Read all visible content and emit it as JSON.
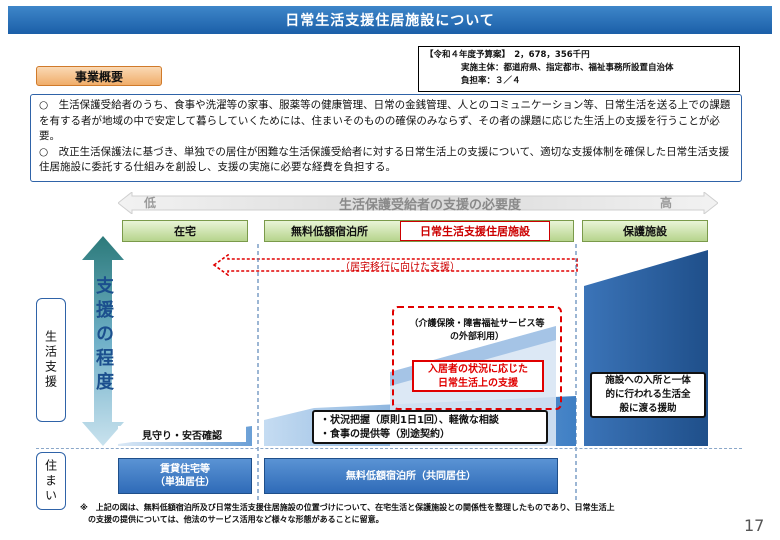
{
  "title": "日常生活支援住居施設について",
  "budget": {
    "line1": "【令和４年度予算案】　2，678，356千円",
    "line2": "実施主体：都道府県、指定都市、福祉事務所設置自治体",
    "line3": "負担率：３／４"
  },
  "overview_label": "事業概要",
  "description": [
    "○　生活保護受給者のうち、食事や洗濯等の家事、服薬等の健康管理、日常の金銭管理、人とのコミュニケーション等、日常生活を送る上での課題を有する者が地域の中で安定して暮らしていくためには、住まいそのものの確保のみならず、その者の課題に応じた生活上の支援を行うことが必要。",
    "○　改正生活保護法に基づき、単独での居住が困難な生活保護受給者に対する日常生活上の支援について、適切な支援体制を確保した日常生活支援住居施設に委託する仕組みを創設し、支援の実施に必要な経費を負担する。"
  ],
  "need_axis": {
    "label": "生活保護受給者の支援の必要度",
    "low": "低",
    "high": "高"
  },
  "categories": {
    "home": "在宅",
    "free_lodging": "無料低額宿泊所",
    "daily_support": "日常生活支援住居施設",
    "protection": "保護施設"
  },
  "transition_label": "（居宅移行に向けた支援）",
  "life_support_label": "生活支援",
  "support_degree_label": "支援の程度",
  "housing_label": "住まい",
  "notes": {
    "watch": "見守り・安否確認",
    "status_line1": "・状況把握（原則1日1回）、軽微な相談",
    "status_line2": "・食事の提供等（別途契約）",
    "external_line1": "（介護保険・障害福祉サービス等",
    "external_line2": "の外部利用）",
    "resident_line1": "入居者の状況に応じた",
    "resident_line2": "日常生活上の支援",
    "facility_line1": "施設への入所と一体",
    "facility_line2": "的に行われる生活全",
    "facility_line3": "般に渡る援助"
  },
  "housing": {
    "rental_line1": "賃貸住宅等",
    "rental_line2": "（単独居住）",
    "shared": "無料低額宿泊所（共同居住）"
  },
  "footnote_line1": "※　上記の図は、無料低額宿泊所及び日常生活支援住居施設の位置づけについて、在宅生活と保護施設との関係性を整理したものであり、日常生活上",
  "footnote_line2": "　の支援の提供については、他法のサービス活用など様々な形態があることに留意。",
  "page_number": "17",
  "colors": {
    "accent_blue": "#2f6bb8",
    "alert_red": "#e00000",
    "category_green": "#b6d48c",
    "overview_orange": "#f0ad6a"
  }
}
